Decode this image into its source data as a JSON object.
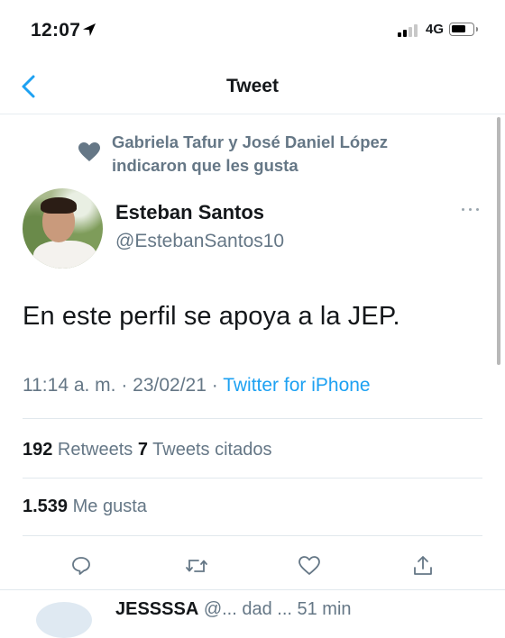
{
  "status_bar": {
    "time": "12:07",
    "network": "4G"
  },
  "nav": {
    "title": "Tweet",
    "back_icon": "chevron-left-icon"
  },
  "social_context": {
    "icon": "heart-filled-icon",
    "line1": "Gabriela Tafur y José Daniel López",
    "line2": "indicaron que les gusta"
  },
  "author": {
    "name": "Esteban Santos",
    "handle": "@EstebanSantos10"
  },
  "tweet": {
    "text": "En este perfil se apoya a la JEP.",
    "timestamp": "11:14 a. m. · 23/02/21 · ",
    "source": "Twitter for iPhone"
  },
  "stats": {
    "retweets_count": "192",
    "retweets_label": " Retweets ",
    "quotes_count": "7",
    "quotes_label": " Tweets citados",
    "likes_count": "1.539",
    "likes_label": " Me gusta"
  },
  "actions": [
    "reply-icon",
    "retweet-icon",
    "like-icon",
    "share-icon"
  ],
  "next_reply": {
    "name": "JESSSSA",
    "rest": " @... dad ... 51 min"
  },
  "colors": {
    "accent": "#1da1f2",
    "secondary_text": "#657786",
    "divider": "#e1e8ed"
  }
}
